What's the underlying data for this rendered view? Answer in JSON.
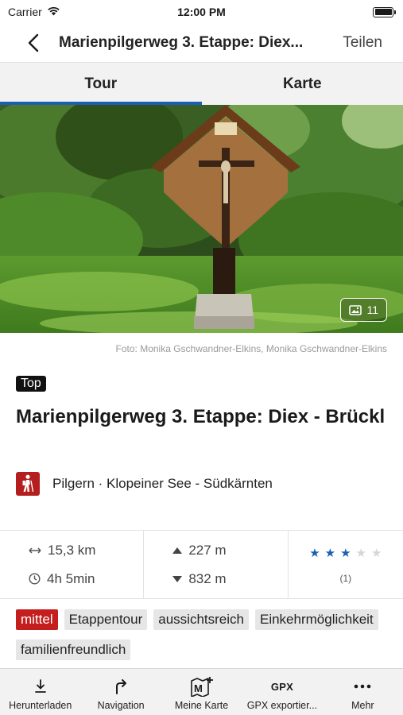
{
  "status_bar": {
    "carrier": "Carrier",
    "time": "12:00 PM"
  },
  "nav": {
    "title": "Marienpilgerweg 3. Etappe: Diex...",
    "share_label": "Teilen"
  },
  "tabs": [
    {
      "label": "Tour",
      "active": true
    },
    {
      "label": "Karte",
      "active": false
    }
  ],
  "hero": {
    "photo_count": "11"
  },
  "caption": "Foto: Monika Gschwandner-Elkins, Monika Gschwandner-Elkins",
  "badge": "Top",
  "title": "Marienpilgerweg 3. Etappe: Diex - Brückl",
  "category": {
    "icon": "hiker-icon",
    "text": "Pilgern · Klopeiner See - Südkärnten"
  },
  "stats": {
    "distance": "15,3 km",
    "duration": "4h 5min",
    "ascent": "227 m",
    "descent": "832 m",
    "rating_stars": 3,
    "rating_max": 5,
    "rating_count": "(1)"
  },
  "tags": [
    {
      "label": "mittel",
      "highlight": true
    },
    {
      "label": "Etappentour",
      "highlight": false
    },
    {
      "label": "aussichtsreich",
      "highlight": false
    },
    {
      "label": "Einkehrmöglichkeit",
      "highlight": false
    },
    {
      "label": "familienfreundlich",
      "highlight": false
    }
  ],
  "bottom_bar": [
    {
      "label": "Herunterladen",
      "icon": "download-icon"
    },
    {
      "label": "Navigation",
      "icon": "turn-arrow-icon"
    },
    {
      "label": "Meine Karte",
      "icon": "map-add-icon"
    },
    {
      "label": "GPX exportier...",
      "icon": "gpx-icon",
      "icon_text": "GPX"
    },
    {
      "label": "Mehr",
      "icon": "more-icon"
    }
  ],
  "colors": {
    "accent": "#1a5fb4",
    "tag_red": "#c41e1e",
    "category_red": "#b51e1e"
  }
}
